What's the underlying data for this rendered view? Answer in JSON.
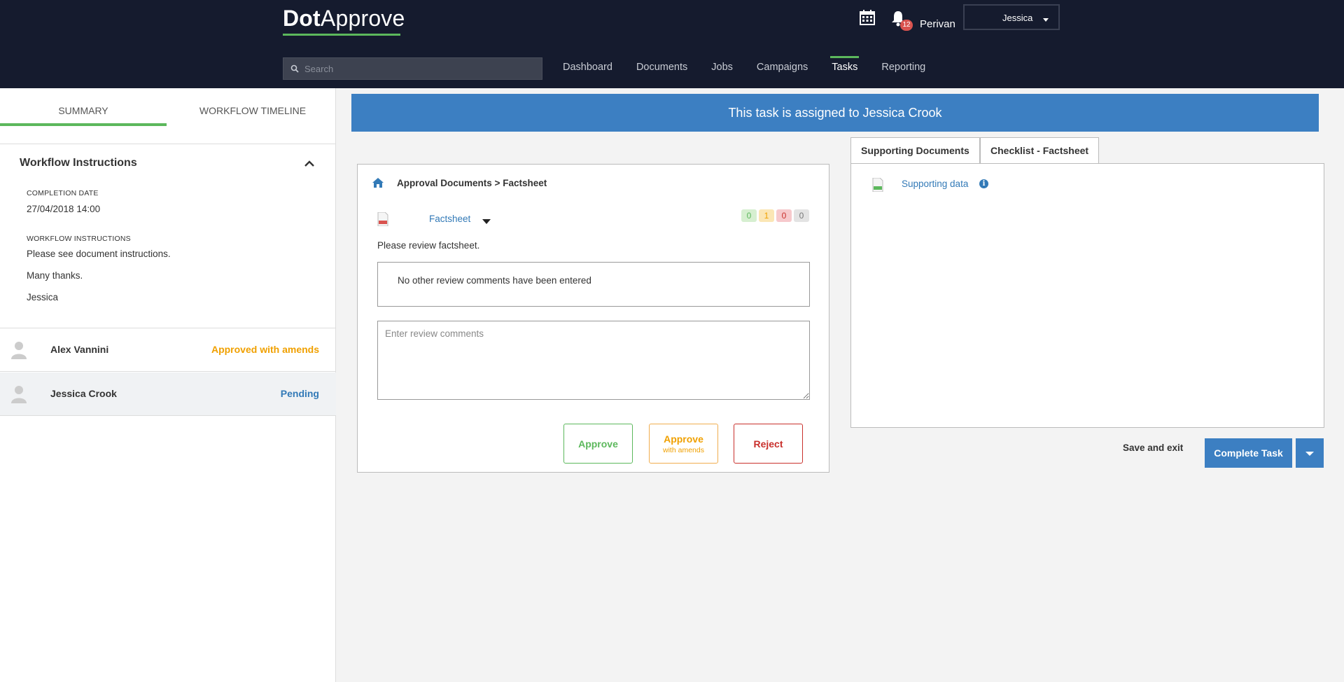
{
  "header": {
    "logo_dot": "Dot",
    "logo_rest": "Approve",
    "notification_count": "12",
    "company": "Perivan",
    "user_select_value": "Jessica",
    "search_placeholder": "Search",
    "nav": [
      "Dashboard",
      "Documents",
      "Jobs",
      "Campaigns",
      "Tasks",
      "Reporting"
    ],
    "active_nav": "Tasks"
  },
  "left_panel": {
    "tabs": [
      "SUMMARY",
      "WORKFLOW TIMELINE"
    ],
    "active_tab": "SUMMARY",
    "section_title": "Workflow Instructions",
    "completion_label": "COMPLETION DATE",
    "completion_value": "27/04/2018 14:00",
    "instructions_label": "WORKFLOW INSTRUCTIONS",
    "instructions_lines": [
      "Please see document instructions.",
      "Many thanks.",
      "Jessica"
    ],
    "approvers": [
      {
        "name": "Alex Vannini",
        "status": "Approved with amends",
        "status_color": "#f0a000"
      },
      {
        "name": "Jessica Crook",
        "status": "Pending",
        "status_color": "#337ab7"
      }
    ]
  },
  "banner": {
    "text": "This task is assigned to Jessica Crook"
  },
  "review": {
    "crumb_parent": "Approval Documents",
    "crumb_sep": ">",
    "crumb_current": "Factsheet",
    "document_name": "Factsheet",
    "counts": [
      {
        "value": "0",
        "bg": "#d6efd0",
        "color": "#5cb85c"
      },
      {
        "value": "1",
        "bg": "#fbe6b5",
        "color": "#f0a000"
      },
      {
        "value": "0",
        "bg": "#f6c9cc",
        "color": "#c9302c"
      },
      {
        "value": "0",
        "bg": "#e3e3e3",
        "color": "#777777"
      }
    ],
    "note": "Please review factsheet.",
    "no_comments": "No other review comments have been entered",
    "comment_placeholder": "Enter review comments",
    "approve_label": "Approve",
    "amends_label": "Approve",
    "amends_sub": "with amends",
    "reject_label": "Reject"
  },
  "support": {
    "tabs": [
      "Supporting Documents",
      "Checklist - Factsheet"
    ],
    "active_tab": "Supporting Documents",
    "link": "Supporting data",
    "info_glyph": "i",
    "save_exit": "Save and exit",
    "complete": "Complete Task"
  },
  "colors": {
    "accent_green": "#5cb85c",
    "banner_blue": "#3c7fc2",
    "header_bg": "#151b2e"
  }
}
